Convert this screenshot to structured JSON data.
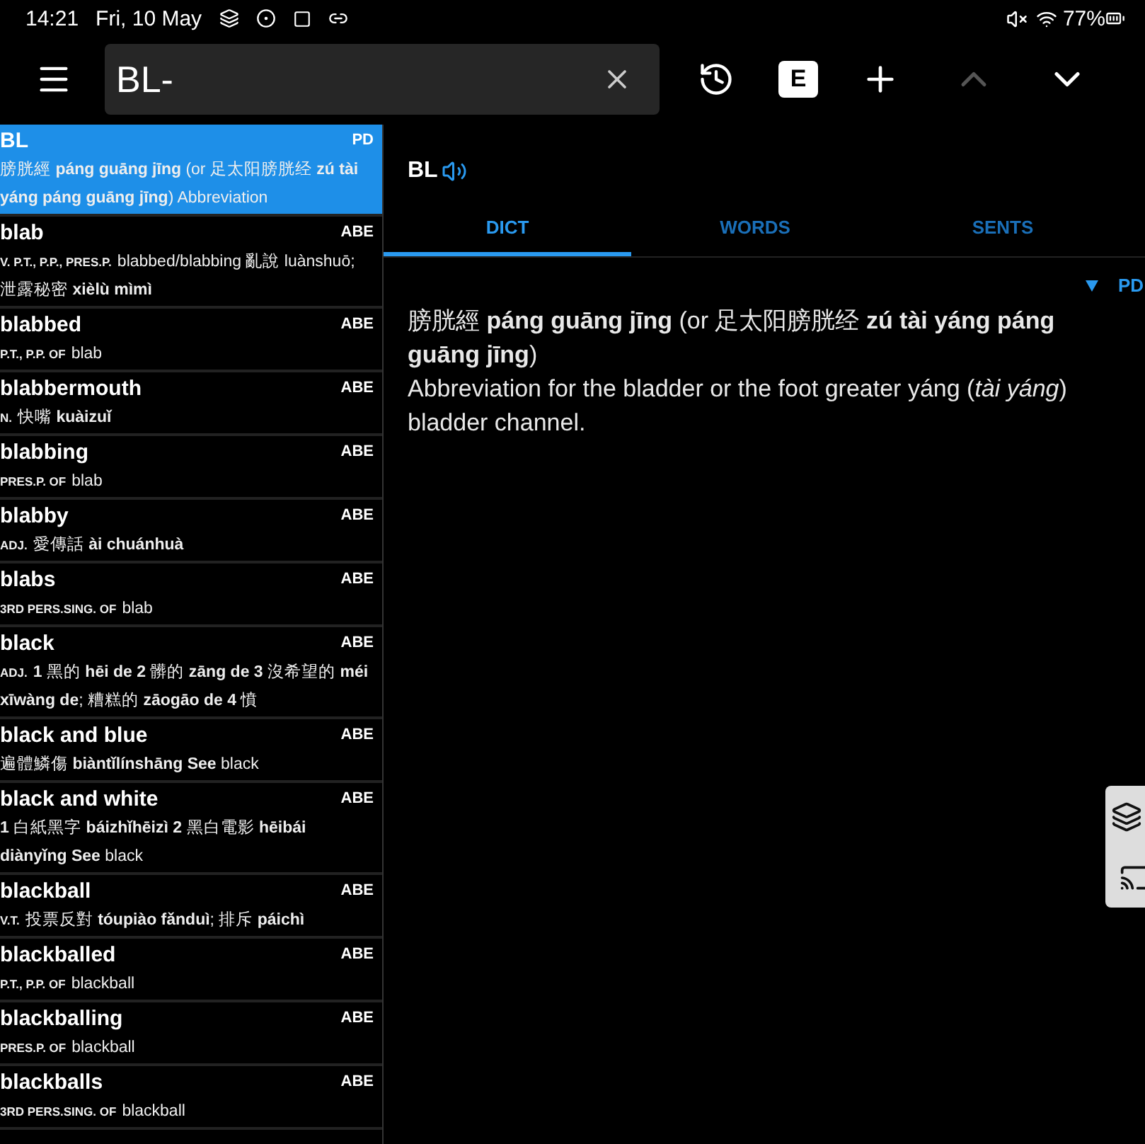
{
  "status_bar": {
    "time": "14:21",
    "date": "Fri, 10 May",
    "battery": "77%"
  },
  "search": {
    "value": "BL-"
  },
  "toolbar": {
    "mode_badge": "E",
    "prev_button": {
      "disabled": true
    },
    "next_button": {
      "disabled": false
    }
  },
  "entries": [
    {
      "headword": "BL",
      "source": "PD",
      "selected": true,
      "text": "膀胱經 **páng guāng jīng** (or 足太阳膀胱经 **zú tài yáng páng guāng jīng**) Abbreviation"
    },
    {
      "headword": "blab",
      "source": "ABE",
      "selected": false,
      "pos": "V. P.T., P.P., PRES.P.",
      "text": "blabbed/blabbing 亂說 luànshuō; 泄露秘密 **xièlù mìmì**"
    },
    {
      "headword": "blabbed",
      "source": "ABE",
      "selected": false,
      "pos": "P.T., P.P. OF",
      "text": "blab"
    },
    {
      "headword": "blabbermouth",
      "source": "ABE",
      "selected": false,
      "pos": "N.",
      "text": "快嘴 **kuàizuǐ**"
    },
    {
      "headword": "blabbing",
      "source": "ABE",
      "selected": false,
      "pos": "PRES.P. OF",
      "text": "blab"
    },
    {
      "headword": "blabby",
      "source": "ABE",
      "selected": false,
      "pos": "ADJ.",
      "text": "愛傳話 **ài chuánhuà**"
    },
    {
      "headword": "blabs",
      "source": "ABE",
      "selected": false,
      "pos": "3RD PERS.SING. OF",
      "text": "blab"
    },
    {
      "headword": "black",
      "source": "ABE",
      "selected": false,
      "pos": "ADJ.",
      "text": "**1** 黑的 **hēi de** **2** 髒的 **zāng de** **3** 沒希望的 **méi xīwàng de**; 糟糕的 **zāogāo de** **4** 憤"
    },
    {
      "headword": "black and blue",
      "source": "ABE",
      "selected": false,
      "text": "遍體鱗傷 **biàntǐlínshāng** **See** black"
    },
    {
      "headword": "black and white",
      "source": "ABE",
      "selected": false,
      "text": "**1** 白紙黑字 **báizhǐhēizì** **2** 黑白電影 **hēibái diànyǐng** **See** black"
    },
    {
      "headword": "blackball",
      "source": "ABE",
      "selected": false,
      "pos": "V.T.",
      "text": "投票反對 **tóupiào fǎnduì**; 排斥 **páichì**"
    },
    {
      "headword": "blackballed",
      "source": "ABE",
      "selected": false,
      "pos": "P.T., P.P. OF",
      "text": "blackball"
    },
    {
      "headword": "blackballing",
      "source": "ABE",
      "selected": false,
      "pos": "PRES.P. OF",
      "text": "blackball"
    },
    {
      "headword": "blackballs",
      "source": "ABE",
      "selected": false,
      "pos": "3RD PERS.SING. OF",
      "text": "blackball"
    }
  ],
  "detail": {
    "headword": "BL",
    "tabs": [
      {
        "label": "DICT",
        "selected": true
      },
      {
        "label": "WORDS",
        "selected": false
      },
      {
        "label": "SENTS",
        "selected": false
      }
    ],
    "source": "PD",
    "chinese_line": "膀胱經 **páng guāng jīng** (or 足太阳膀胱经 **zú tài yáng páng guāng jīng**)",
    "definition": "Abbreviation for the bladder or the foot greater yáng (*tài yáng*) bladder channel."
  }
}
